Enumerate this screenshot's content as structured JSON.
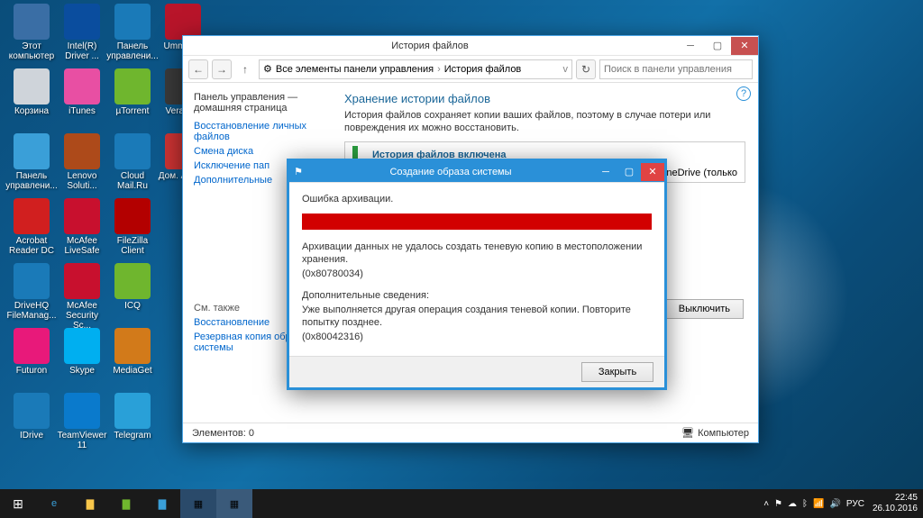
{
  "desktop_icons": [
    {
      "label": "Этот компьютер",
      "col": 0,
      "row": 0,
      "bg": "#3a6ea5"
    },
    {
      "label": "Intel(R) Driver ...",
      "col": 1,
      "row": 0,
      "bg": "#0a4d9e"
    },
    {
      "label": "Панель управлени...",
      "col": 2,
      "row": 0,
      "bg": "#1a7ab8"
    },
    {
      "label": "UmmyV...",
      "col": 3,
      "row": 0,
      "bg": "#b8152a"
    },
    {
      "label": "Корзина",
      "col": 0,
      "row": 1,
      "bg": "#cfd4da"
    },
    {
      "label": "iTunes",
      "col": 1,
      "row": 1,
      "bg": "#e84fa3"
    },
    {
      "label": "µTorrent",
      "col": 2,
      "row": 1,
      "bg": "#6fb62e"
    },
    {
      "label": "VeraCr...",
      "col": 3,
      "row": 1,
      "bg": "#3a3a3a"
    },
    {
      "label": "Панель управлени...",
      "col": 0,
      "row": 2,
      "bg": "#3a9fd8"
    },
    {
      "label": "Lenovo Soluti...",
      "col": 1,
      "row": 2,
      "bg": "#ad4a1a"
    },
    {
      "label": "Cloud Mail.Ru",
      "col": 2,
      "row": 2,
      "bg": "#1a7ab8"
    },
    {
      "label": "Дом. Аген...",
      "col": 3,
      "row": 2,
      "bg": "#cc3333"
    },
    {
      "label": "Acrobat Reader DC",
      "col": 0,
      "row": 3,
      "bg": "#d11f1f"
    },
    {
      "label": "McAfee LiveSafe",
      "col": 1,
      "row": 3,
      "bg": "#c8102e"
    },
    {
      "label": "FileZilla Client",
      "col": 2,
      "row": 3,
      "bg": "#b30000"
    },
    {
      "label": "DriveHQ FileManag...",
      "col": 0,
      "row": 4,
      "bg": "#1a7ab8"
    },
    {
      "label": "McAfee Security Sc...",
      "col": 1,
      "row": 4,
      "bg": "#c8102e"
    },
    {
      "label": "ICQ",
      "col": 2,
      "row": 4,
      "bg": "#6fb62e"
    },
    {
      "label": "Futuron",
      "col": 0,
      "row": 5,
      "bg": "#e8197a"
    },
    {
      "label": "Skype",
      "col": 1,
      "row": 5,
      "bg": "#00aff0"
    },
    {
      "label": "MediaGet",
      "col": 2,
      "row": 5,
      "bg": "#d27a1a"
    },
    {
      "label": "IDrive",
      "col": 0,
      "row": 6,
      "bg": "#1a7ab8"
    },
    {
      "label": "TeamViewer 11",
      "col": 1,
      "row": 6,
      "bg": "#0a7acc"
    },
    {
      "label": "Telegram",
      "col": 2,
      "row": 6,
      "bg": "#29a0d8"
    }
  ],
  "cp": {
    "title": "История файлов",
    "crumb1": "Все элементы панели управления",
    "crumb2": "История файлов",
    "search_placeholder": "Поиск в панели управления",
    "sidebar": {
      "header": "Панель управления — домашняя страница",
      "links": [
        "Восстановление личных файлов",
        "Смена диска",
        "Исключение пап",
        "Дополнительные"
      ],
      "also_label": "См. также",
      "also_links": [
        "Восстановление",
        "Резервная копия образа системы"
      ]
    },
    "content": {
      "heading": "Хранение истории файлов",
      "desc": "История файлов сохраняет копии ваших файлов, поэтому в случае потери или повреждения их можно восстановить.",
      "enabled": "История файлов включена",
      "right_note": "и OneDrive (только",
      "off_btn": "Выключить"
    },
    "status": {
      "left": "Элементов: 0",
      "right": "Компьютер"
    }
  },
  "dlg": {
    "title": "Создание образа системы",
    "err_title": "Ошибка архивации.",
    "line1": "Архивации данных не удалось создать теневую копию в местоположении хранения.",
    "code1": "(0x80780034)",
    "extra_label": "Дополнительные сведения:",
    "line2": "Уже выполняется другая операция создания теневой копии. Повторите попытку позднее.",
    "code2": "(0x80042316)",
    "close_btn": "Закрыть"
  },
  "taskbar": {
    "lang": "РУС",
    "time": "22:45",
    "date": "26.10.2016"
  }
}
